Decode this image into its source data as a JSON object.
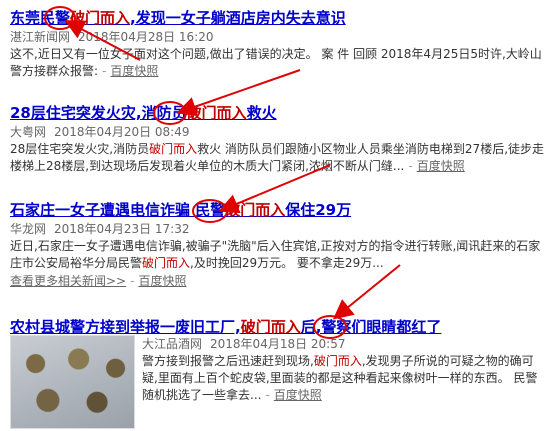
{
  "results": [
    {
      "title_pre": "东莞民警",
      "title_hl": "破门而入",
      "title_post": ",发现一女子躺酒店房内失去意识",
      "source": "湛江新闻网",
      "date": "2018年04月28日 16:20",
      "snippet": "这不,近日又有一位女子面对这个问题,做出了错误的决定。      案 件 回顾    2018年4月25日5时许,大岭山警方接群众报警:",
      "snapshot": "百度快照"
    },
    {
      "title_pre": "28层住宅突发火灾,消防员",
      "title_hl": "破门而入",
      "title_post": "救火",
      "source": "大粤网",
      "date": "2018年04月20日 08:49",
      "snippet_pre": "28层住宅突发火灾,消防员",
      "snippet_hl": "破门而入",
      "snippet_post": "救火 消防队员们跟随小区物业人员乘坐消防电梯到27楼后,徒步走楼梯上28楼层,到达现场后发现着火单位的木质大门紧闭,浓烟不断从门缝...",
      "snapshot": "百度快照"
    },
    {
      "title_pre": "石家庄一女子遭遇电信诈骗 民警",
      "title_hl": "破门而入",
      "title_post": "保住29万",
      "source": "华龙网",
      "date": "2018年04月23日 17:32",
      "snippet_pre": "近日,石家庄一女子遭遇电信诈骗,被骗子\"洗脑\"后入住宾馆,正按对方的指令进行转账,闻讯赶来的石家庄市公安局裕华分局民警",
      "snippet_hl": "破门而入",
      "snippet_post": ",及时挽回29万元。 要不拿走29万...",
      "more": "查看更多相关新闻>>",
      "snapshot": "百度快照"
    },
    {
      "title_pre": "农村县城警方接到举报一废旧工厂,",
      "title_hl": "破门而入",
      "title_post": "后,警察们眼睛都红了",
      "source": "大江品酒网",
      "date": "2018年04月18日 20:57",
      "snippet_pre": "警方接到报警之后迅速赶到现场,",
      "snippet_hl": "破门而入",
      "snippet_post": ",发现男子所说的可疑之物的确可疑,里面有上百个蛇皮袋,里面装的都是这种看起来像树叶一样的东西。 民警随机挑选了一些拿去...",
      "snapshot": "百度快照",
      "thumbnail_icon": "image-thumbnail"
    }
  ],
  "annotation_color": "#e00000"
}
